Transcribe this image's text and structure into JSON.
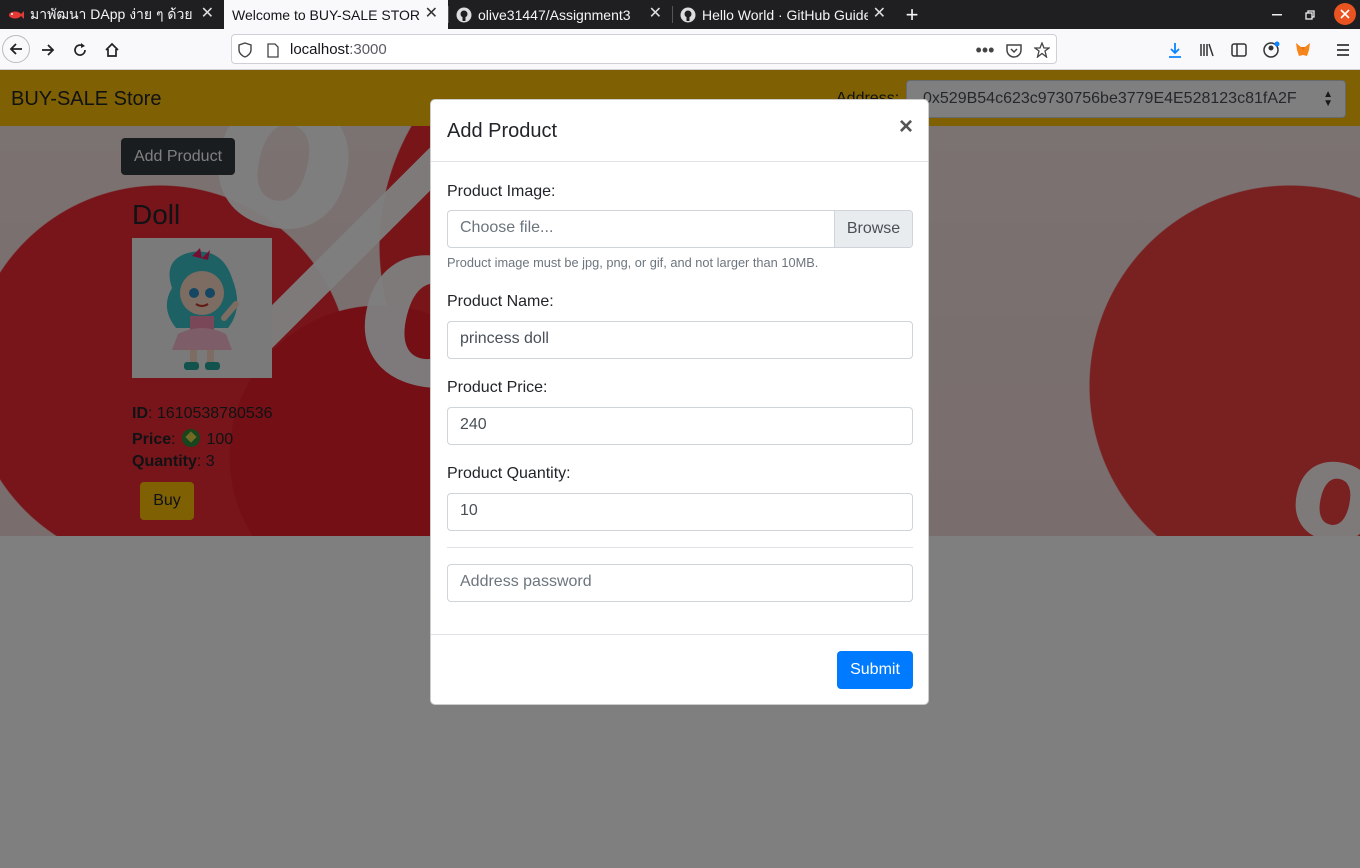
{
  "browser": {
    "tabs": [
      {
        "title": "มาพัฒนา DApp ง่าย ๆ ด้วย",
        "icon": "red-fish-icon",
        "active": false
      },
      {
        "title": "Welcome to BUY-SALE STORE",
        "icon": "",
        "active": true
      },
      {
        "title": "olive31447/Assignment3",
        "icon": "github-icon",
        "active": false
      },
      {
        "title": "Hello World · GitHub Guides",
        "icon": "github-icon",
        "active": false
      }
    ],
    "url_host": "localhost",
    "url_port": ":3000"
  },
  "header": {
    "brand": "BUY-SALE Store",
    "address_label": "Address:",
    "address_value": "0x529B54c623c9730756be3779E4E528123c81fA2F"
  },
  "page": {
    "add_product_label": "Add Product",
    "product": {
      "name": "Doll",
      "id_label": "ID",
      "id_value": ": 1610538780536",
      "price_label": "Price",
      "price_value": "100",
      "quantity_label": "Quantity",
      "quantity_value": ": 3",
      "buy_label": "Buy"
    }
  },
  "modal": {
    "title": "Add Product",
    "close": "×",
    "image_label": "Product Image:",
    "file_placeholder": "Choose file...",
    "browse_label": "Browse",
    "image_help": "Product image must be jpg, png, or gif, and not larger than 10MB.",
    "name_label": "Product Name:",
    "name_value": "princess doll",
    "price_label": "Product Price:",
    "price_value": "240",
    "quantity_label": "Product Quantity:",
    "quantity_value": "10",
    "password_placeholder": "Address password",
    "submit_label": "Submit"
  },
  "colors": {
    "header_bg": "#ffc107",
    "submit_bg": "#007bff",
    "add_btn_bg": "#343a40"
  }
}
